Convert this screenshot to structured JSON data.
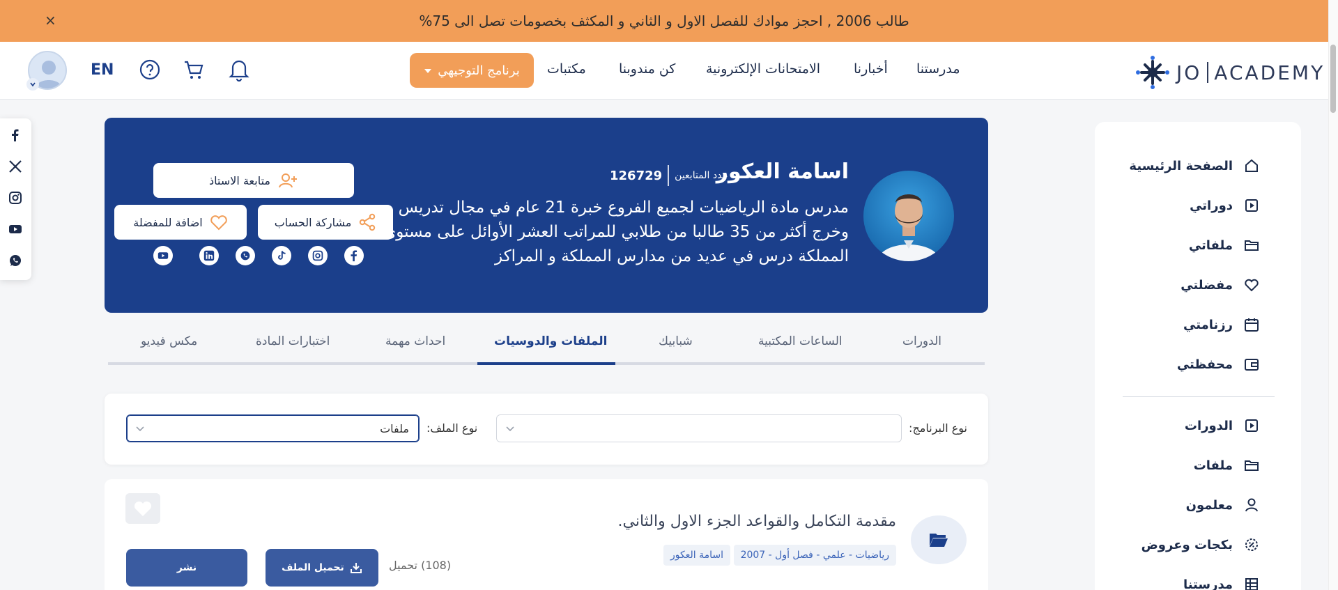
{
  "promo": {
    "text": "طالب 2006 , احجز موادك للفصل الاول و الثاني و المكثف بخصومات تصل الى 75%",
    "close": "×"
  },
  "nav": {
    "logo_left": "JO",
    "logo_right": "ACADEMY",
    "links": [
      "مدرستنا",
      "أخبارنا",
      "الامتحانات الإلكترونية",
      "كن مندوبنا",
      "مكتبات"
    ],
    "program_button": "برنامج التوجيهي",
    "lang": "EN"
  },
  "sidebar": {
    "items": [
      {
        "label": "الصفحة الرئيسية",
        "icon": "home-icon"
      },
      {
        "label": "دوراتي",
        "icon": "play-square-icon"
      },
      {
        "label": "ملفاتي",
        "icon": "folder-icon"
      },
      {
        "label": "مفضلتي",
        "icon": "heart-icon"
      },
      {
        "label": "رزنامتي",
        "icon": "calendar-icon"
      },
      {
        "label": "محفظتي",
        "icon": "wallet-icon"
      },
      {
        "label": "الدورات",
        "icon": "play-square-icon"
      },
      {
        "label": "ملفات",
        "icon": "folder-icon"
      },
      {
        "label": "معلمون",
        "icon": "user-icon"
      },
      {
        "label": "بكجات وعروض",
        "icon": "badge-icon"
      },
      {
        "label": "مدرستنا",
        "icon": "grid-icon"
      }
    ]
  },
  "teacher": {
    "name": "اسامة العكور",
    "followers_label": "عدد المتابعين",
    "followers_count": "126729",
    "bio_lines": [
      "مدرس مادة الرياضيات لجميع الفروع خبرة 21 عام في مجال تدريس",
      "وخرج أكثر من 35 طالبا من طلابي للمراتب العشر الأوائل على مستوى",
      "المملكة درس في عديد من مدارس المملكة و المراكز"
    ],
    "follow_button": "متابعة الاستاذ",
    "share_button": "مشاركة الحساب",
    "favorite_button": "اضافة للمفضلة",
    "socials": [
      "facebook-icon",
      "instagram-icon",
      "tiktok-icon",
      "whatsapp-icon",
      "linkedin-icon",
      "youtube-icon"
    ]
  },
  "tabs": {
    "items": [
      "الدورات",
      "الساعات المكتبية",
      "شبابيك",
      "الملفات والدوسيات",
      "احداث مهمة",
      "اختبارات المادة",
      "مكس فيديو"
    ],
    "active": "الملفات والدوسيات"
  },
  "filters": {
    "program_label": "نوع البرنامج:",
    "program_value": "",
    "file_type_label": "نوع الملف:",
    "file_type_value": "ملفات"
  },
  "file": {
    "title": "مقدمة التكامل والقواعد الجزء الاول والثاني.",
    "tags": [
      "رياضيات - علمي - فصل أول - 2007",
      "اسامة العكور"
    ],
    "downloads": "(108) تحميل",
    "download_button": "تحميل الملف",
    "publish_button": "نشر"
  },
  "colors": {
    "primary": "#1b3f8b",
    "accent": "#f29e58",
    "button_blue": "#3a5ba0"
  }
}
